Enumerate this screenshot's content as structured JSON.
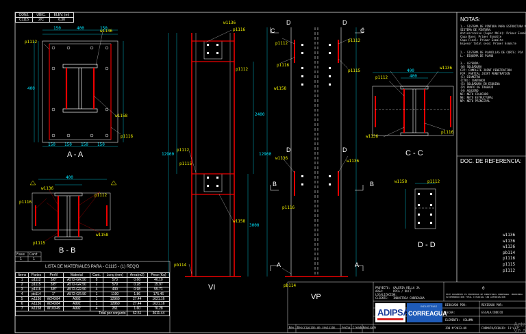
{
  "header": {
    "cols": [
      "CONJ.",
      "UBIC.",
      "ELEV. (m)"
    ],
    "vals": [
      "C1115",
      "2/C",
      "6.30"
    ]
  },
  "views": {
    "aa": "A - A",
    "bb": "B - B",
    "cc": "C - C",
    "dd": "D - D",
    "vi": "VI",
    "vp": "VP"
  },
  "section_marks": {
    "a": "A",
    "b": "B",
    "c": "C",
    "d": "D"
  },
  "part_tags": [
    "p1112",
    "p1116",
    "w1136",
    "w1158",
    "pb114",
    "p1115",
    "p1113"
  ],
  "notes": {
    "title": "NOTAS:",
    "lines": [
      "1.- SISTEMA DE PINTURA PARA ESTRUCTURA METALICA",
      "  SISTEMA DE PINTURA:",
      "  Anticorrosivo (Super Mold): Primer Esmalte",
      "  Capa Base: Primer Esmalte",
      "  Capa Final: Primer Esmalte",
      "  Espesor total seco: Primer Esmalte",
      "2.- SISTEMA DE PLANILLAS DE CORTE:   PCA",
      "  L.- ESQUEMA DE PLANO",
      "3.- LEYENDA:",
      "  (W) SOLDADURA",
      "  CJP: COMPLETE JOINT PENETRATION",
      "  PJP: PARTIAL JOINT PENETRATION",
      "  (C) DIAMETRO",
      "  (CTR): CENTRADO",
      "  (S) SOLDADURA EN ESQUINA",
      "  (P) PUNTO DE TRABAJO",
      "  (H) AGUJERO",
      "  NC: NETO COLOCADO",
      "  NE: NETO ESTRUCTURAL",
      "  NP: NETO PRINCIPAL"
    ],
    "ref_title": "DOC. DE REFERENCIA:",
    "part_list": [
      "w1136",
      "w1136",
      "w1136",
      "pb114",
      "p1116",
      "p1115",
      "p1112"
    ]
  },
  "bom": {
    "fase_label": "Fase",
    "cant_label": "Cant",
    "fase_val": "1",
    "cant_val": "1",
    "title": "LISTA DE MATERIALES PARA - C1115 - (1) REQ'D",
    "headers": [
      "Items",
      "Partes",
      "Perfil",
      "Material",
      "Cant.",
      "Long (mm)",
      "Area(m2)",
      "Peso (Kg)"
    ],
    "rows": [
      [
        "1",
        "p1112",
        "3/8\"",
        "A572-GR.50",
        "8",
        "573",
        "0.66",
        "46.10"
      ],
      [
        "2",
        "p1115",
        "3/8\"",
        "A572-GR.50",
        "2",
        "579",
        "0.28",
        "15.97"
      ],
      [
        "3",
        "p1116",
        "3/8\"",
        "A572-GR.50",
        "4",
        "430",
        "0.98",
        "55.71"
      ],
      [
        "4",
        "pb114",
        "1\"",
        "A572-GR.50",
        "1",
        "1100",
        "1.86",
        "175.46"
      ],
      [
        "5",
        "w1136",
        "W24X84",
        "A992",
        "1",
        "12960",
        "27.44",
        "1621.16"
      ],
      [
        "6",
        "w1136",
        "W24X84",
        "A992",
        "1",
        "12960",
        "27.44",
        "1621.16"
      ],
      [
        "7",
        "w1158",
        "W10X49",
        "A992",
        "4",
        "261",
        "1.60",
        "76.28"
      ]
    ],
    "total_label": "Total por conjunto",
    "total_area": "62.51",
    "total_weight": "3611.44"
  },
  "titleblock": {
    "proyecto_label": "PROYECTO:",
    "proyecto_val": "GALERIA RELLA JA",
    "area_label": "AREA:",
    "area_val": "PPCA / DUCT",
    "localizacion_label": "LOCALIZACION:",
    "cliente_label": "CLIENTE:",
    "cliente_val": "INDUSTRIA CORREAGUA",
    "dibujado": "DIBUJADO POR:",
    "revisado": "REVISADO POR:",
    "fecha": "FECHA:",
    "fecha_val": "ESCALA/INDICO",
    "elemento": "ELEMENTO:",
    "elemento_val": "COLUMN",
    "job": "JOB N°2023-09",
    "formato": "FORMATO/DIBUJO: 11\"x17\"",
    "rev_num": "0",
    "logo_left": "ADIPSA",
    "logo_right": "CORREAGUA",
    "logo_right_top": "INDUSTRIAS",
    "rev_headers": [
      "Rev",
      "Descripción de revisión",
      "Fecha",
      "Creado",
      "Revisado"
    ],
    "disclaimer": "ESTE DOCUMENTO ES PROPIEDAD DE INDUSTRIAS CORREAGUA. PROHIBIDA SU REPRODUCCION TOTAL O PARCIAL SIN AUTORIZACION"
  },
  "dims": {
    "aa_top": [
      "150",
      "400",
      "150"
    ],
    "aa_bottom": [
      "150",
      "150",
      "150",
      "150"
    ],
    "aa_side": "400",
    "bb_top": "400",
    "bb_top2": "400",
    "cc_top": "400",
    "cc_top2": "400",
    "vi_height": "12960",
    "vp_height": "12960",
    "elev_a": "2400",
    "elev_b": "3000"
  },
  "watermark": "Activ\nVe a C"
}
